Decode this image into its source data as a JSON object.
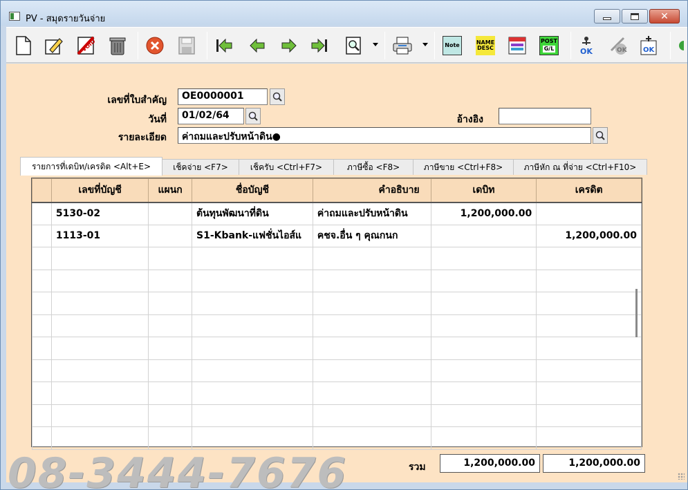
{
  "window": {
    "title": "PV - สมุดรายวันจ่าย"
  },
  "toolbar": {
    "note_label": "Note",
    "name_desc_label_1": "NAME",
    "name_desc_label_2": "DESC",
    "post_gl_label_1": "POST",
    "post_gl_label_2": "G/L",
    "ok_label": "OK"
  },
  "header": {
    "doc_no_label": "เลขที่ใบสำคัญ",
    "doc_no_value": "OE0000001",
    "date_label": "วันที่",
    "date_value": "01/02/64",
    "reference_label": "อ้างอิง",
    "reference_value": "",
    "description_label": "รายละเอียด",
    "description_value": "ค่าถมและปรับหน้าดิน●"
  },
  "tabs": [
    {
      "label": "รายการที่เดบิท/เครดิต <Alt+E>"
    },
    {
      "label": "เช็คจ่าย <F7>"
    },
    {
      "label": "เช็ครับ <Ctrl+F7>"
    },
    {
      "label": "ภาษีซื้อ <F8>"
    },
    {
      "label": "ภาษีขาย <Ctrl+F8>"
    },
    {
      "label": "ภาษีหัก ณ ที่จ่าย <Ctrl+F10>"
    }
  ],
  "grid": {
    "columns": [
      "เลขที่บัญชี",
      "แผนก",
      "ชื่อบัญชี",
      "คำอธิบาย",
      "เดบิท",
      "เครดิต"
    ],
    "rows": [
      {
        "account": "5130-02",
        "dept": "",
        "name": "ต้นทุนพัฒนาที่ดิน",
        "desc": "ค่าถมและปรับหน้าดิน",
        "debit": "1,200,000.00",
        "credit": ""
      },
      {
        "account": "1113-01",
        "dept": "",
        "name": "S1-Kbank-แฟชั่นไอส์แ",
        "desc": "คชจ.อื่น ๆ       คุณกนก",
        "debit": "",
        "credit": "1,200,000.00"
      }
    ]
  },
  "totals": {
    "label": "รวม",
    "debit": "1,200,000.00",
    "credit": "1,200,000.00"
  },
  "watermark": "08-3444-7676"
}
